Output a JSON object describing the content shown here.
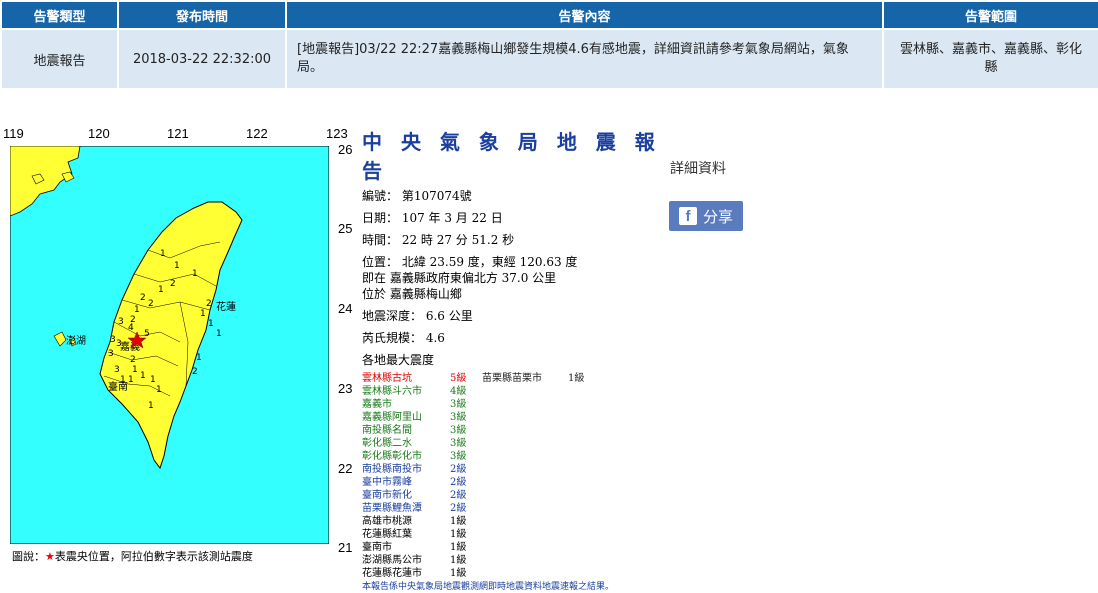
{
  "table": {
    "headers": [
      "告警類型",
      "發布時間",
      "告警內容",
      "告警範圍"
    ],
    "row": {
      "type": "地震報告",
      "time": "2018-03-22 22:32:00",
      "content": "[地震報告]03/22 22:27嘉義縣梅山鄉發生規模4.6有感地震，詳細資訊請參考氣象局網站，氣象局。",
      "area": "雲林縣、嘉義市、嘉義縣、彰化縣"
    }
  },
  "map": {
    "lon_ticks": [
      "119",
      "120",
      "121",
      "122",
      "123"
    ],
    "lat_ticks": [
      "26",
      "25",
      "24",
      "23",
      "22",
      "21"
    ],
    "place_labels": {
      "hualien": "花蓮",
      "chiayi": "嘉義",
      "tainan": "臺南",
      "penghu": "澎湖"
    },
    "station_numbers": [
      "1",
      "1",
      "2",
      "1",
      "1",
      "2",
      "2",
      "1",
      "2",
      "4",
      "3",
      "5",
      "3",
      "3",
      "3",
      "3",
      "2",
      "1",
      "1",
      "1",
      "1",
      "1",
      "1",
      "1",
      "2",
      "1",
      "1",
      "1",
      "1",
      "2"
    ],
    "epicenter_color": "#e00000",
    "land_color": "#ffff33",
    "sea_color": "#33ffff",
    "legend_prefix": "圖說：",
    "legend_star": "★",
    "legend_text": "表震央位置，阿拉伯數字表示該測站震度"
  },
  "report": {
    "title": "中 央 氣 象 局 地 震 報 告",
    "number": "編號： 第107074號",
    "date": "日期： 107 年 3 月 22 日",
    "time": "時間： 22 時 27 分 51.2 秒",
    "position": "位置： 北緯 23.59 度，東經 120.63 度",
    "relative": "即在 嘉義縣政府東偏北方 37.0 公里",
    "located": "位於 嘉義縣梅山鄉",
    "depth": "地震深度： 6.6 公里",
    "magnitude": "芮氏規模： 4.6",
    "intensity_heading": "各地最大震度",
    "stations": [
      {
        "name": "雲林縣古坑",
        "level": "5級",
        "color": "#e00000"
      },
      {
        "name": "雲林縣斗六市",
        "level": "4級",
        "color": "#1a7a1a"
      },
      {
        "name": "嘉義市",
        "level": "3級",
        "color": "#1a7a1a"
      },
      {
        "name": "嘉義縣阿里山",
        "level": "3級",
        "color": "#1a7a1a"
      },
      {
        "name": "南投縣名間",
        "level": "3級",
        "color": "#1a7a1a"
      },
      {
        "name": "彰化縣二水",
        "level": "3級",
        "color": "#1a7a1a"
      },
      {
        "name": "彰化縣彰化市",
        "level": "3級",
        "color": "#1a7a1a"
      },
      {
        "name": "南投縣南投市",
        "level": "2級",
        "color": "#1a3f9e"
      },
      {
        "name": "臺中市霧峰",
        "level": "2級",
        "color": "#1a3f9e"
      },
      {
        "name": "臺南市新化",
        "level": "2級",
        "color": "#1a3f9e"
      },
      {
        "name": "苗栗縣鯉魚潭",
        "level": "2級",
        "color": "#1a3f9e"
      },
      {
        "name": "高雄市桃源",
        "level": "1級",
        "color": "#000000"
      },
      {
        "name": "花蓮縣紅葉",
        "level": "1級",
        "color": "#000000"
      },
      {
        "name": "臺南市",
        "level": "1級",
        "color": "#000000"
      },
      {
        "name": "澎湖縣馬公市",
        "level": "1級",
        "color": "#000000"
      },
      {
        "name": "花蓮縣花蓮市",
        "level": "1級",
        "color": "#000000"
      }
    ],
    "extra_station": {
      "name": "苗栗縣苗栗市",
      "level": "1級"
    },
    "note": "本報告係中央氣象局地震觀測網即時地震資料地震速報之結果。"
  },
  "side": {
    "detail": "詳細資料",
    "share": "分享",
    "share_icon": "facebook-icon"
  }
}
